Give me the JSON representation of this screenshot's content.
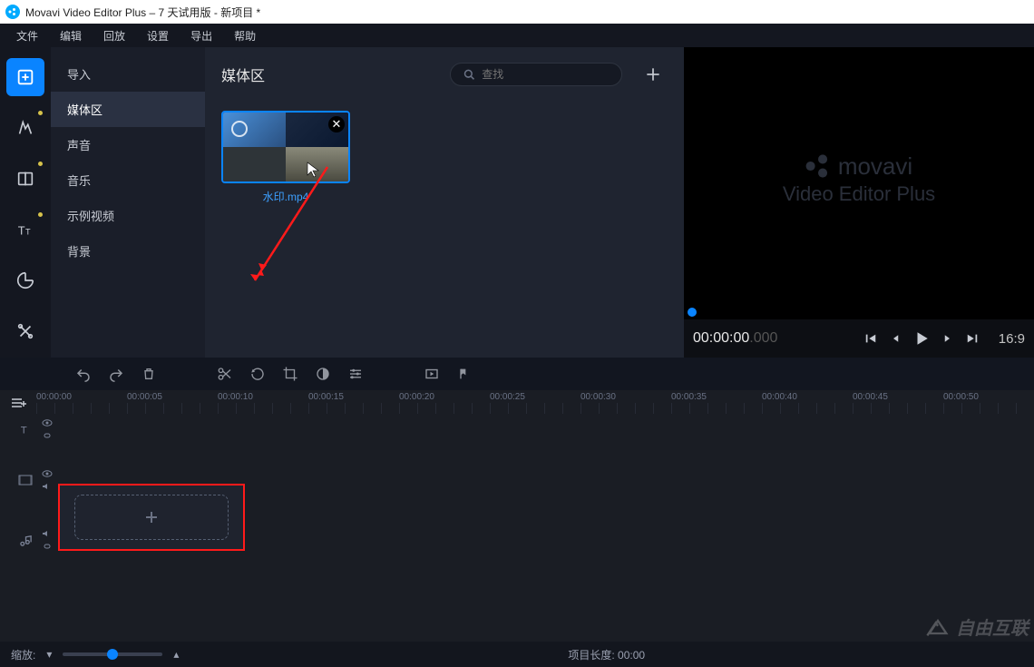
{
  "titlebar": {
    "title": "Movavi Video Editor Plus – 7 天试用版 - 新项目 *"
  },
  "menu": {
    "items": [
      "文件",
      "编辑",
      "回放",
      "设置",
      "导出",
      "帮助"
    ]
  },
  "nav": {
    "items": [
      "导入",
      "媒体区",
      "声音",
      "音乐",
      "示例视频",
      "背景"
    ],
    "active_index": 1
  },
  "media": {
    "title": "媒体区",
    "search_placeholder": "查找",
    "thumb_label": "水印.mp4"
  },
  "preview": {
    "brand_top": "movavi",
    "brand_sub": "Video Editor Plus",
    "timecode": "00:00:00",
    "timecode_ms": ".000",
    "duration_partial": "16:9"
  },
  "timeline": {
    "ruler": [
      "00:00:00",
      "00:00:05",
      "00:00:10",
      "00:00:15",
      "00:00:20",
      "00:00:25",
      "00:00:30",
      "00:00:35",
      "00:00:40",
      "00:00:45",
      "00:00:50"
    ]
  },
  "bottom": {
    "zoom_label": "缩放:",
    "length_label": "项目长度:",
    "length_value": "00:00"
  },
  "corner_watermark": "自由互联"
}
